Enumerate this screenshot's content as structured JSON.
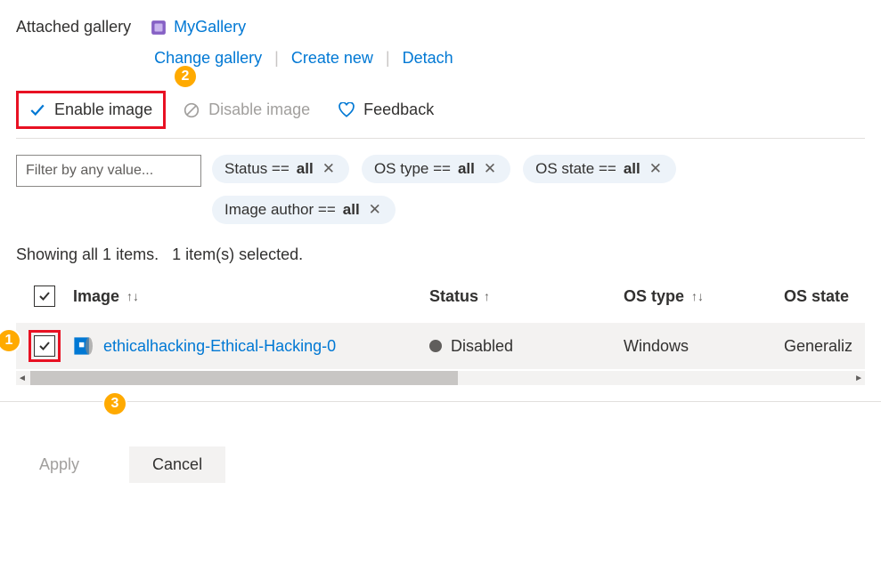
{
  "header": {
    "attached_label": "Attached gallery",
    "gallery_name": "MyGallery",
    "links": {
      "change": "Change gallery",
      "create": "Create new",
      "detach": "Detach"
    }
  },
  "toolbar": {
    "enable": "Enable image",
    "disable": "Disable image",
    "feedback": "Feedback"
  },
  "filter": {
    "placeholder": "Filter by any value...",
    "pills": [
      {
        "prefix": "Status == ",
        "value": "all"
      },
      {
        "prefix": "OS type == ",
        "value": "all"
      },
      {
        "prefix": "OS state == ",
        "value": "all"
      },
      {
        "prefix": "Image author == ",
        "value": "all"
      }
    ]
  },
  "status_line": {
    "showing": "Showing all 1 items.",
    "selected": "1 item(s) selected."
  },
  "table": {
    "headers": {
      "image": "Image",
      "status": "Status",
      "ostype": "OS type",
      "osstate": "OS state"
    },
    "rows": [
      {
        "name": "ethicalhacking-Ethical-Hacking-0",
        "status": "Disabled",
        "ostype": "Windows",
        "osstate": "Generaliz"
      }
    ]
  },
  "footer": {
    "apply": "Apply",
    "cancel": "Cancel"
  },
  "badges": {
    "b1": "1",
    "b2": "2",
    "b3": "3"
  }
}
